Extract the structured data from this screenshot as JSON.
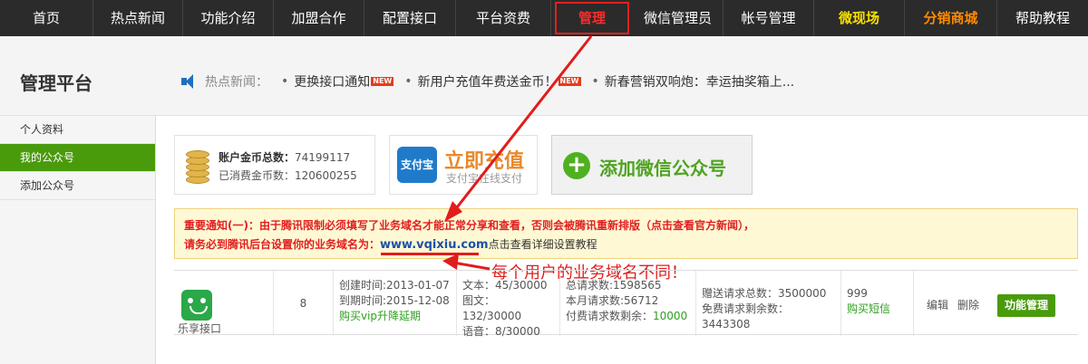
{
  "topnav": {
    "items": [
      "首页",
      "热点新闻",
      "功能介绍",
      "加盟合作",
      "配置接口",
      "平台资费",
      "管理",
      "微信管理员",
      "帐号管理",
      "微现场",
      "分销商城",
      "帮助教程"
    ]
  },
  "header": {
    "title": "管理平台",
    "news_label": "热点新闻：",
    "news": [
      {
        "text": "更换接口通知",
        "badge": "NEW"
      },
      {
        "text": "新用户充值年费送金币！",
        "badge": "NEW"
      },
      {
        "text": "新春营销双响炮：幸运抽奖箱上..."
      }
    ]
  },
  "sidebar": {
    "items": [
      "个人资料",
      "我的公众号",
      "添加公众号"
    ]
  },
  "coins": {
    "total_label": "账户金币总数：",
    "total_value": "74199117",
    "spent_label": "已消费金币数：",
    "spent_value": "120600255"
  },
  "recharge": {
    "icon_text": "支付宝",
    "title": "立即充值",
    "subtitle": "支付宝在线支付"
  },
  "add_account": {
    "label": "添加微信公众号"
  },
  "notice": {
    "line1": "重要通知(一)：由于腾讯限制必须填写了业务域名才能正常分享和查看，否则会被腾讯重新排版（点击查看官方新闻），",
    "line2_prefix": "请务必到腾讯后台设置你的业务域名为：",
    "domain": "www.vqixiu.com",
    "link": "点击查看详细设置教程"
  },
  "callout": "每个用户的业务域名不同！",
  "account_row": {
    "name": "乐享接口",
    "count": "8",
    "created": "创建时间:2013-01-07",
    "expires": "到期时间:2015-12-08",
    "buy_vip": "购买vip升降延期",
    "text_quota": "文本：45/30000",
    "image_quota": "图文：132/30000",
    "voice_quota": "语音：8/30000",
    "total_requests": "总请求数:1598565",
    "month_requests": "本月请求数:56712",
    "paid_remaining_label": "付费请求数剩余：",
    "paid_remaining_value": "10000",
    "gift_total": "赠送请求总数：3500000",
    "free_remaining": "免费请求剩余数：3443308",
    "sms_count": "999",
    "buy_sms": "购买短信",
    "edit": "编辑",
    "delete": "删除",
    "manage": "功能管理"
  },
  "colors": {
    "nav_bg": "#2b2b2b",
    "accent_green": "#4a9b0c",
    "alert_red": "#e21c1c"
  }
}
